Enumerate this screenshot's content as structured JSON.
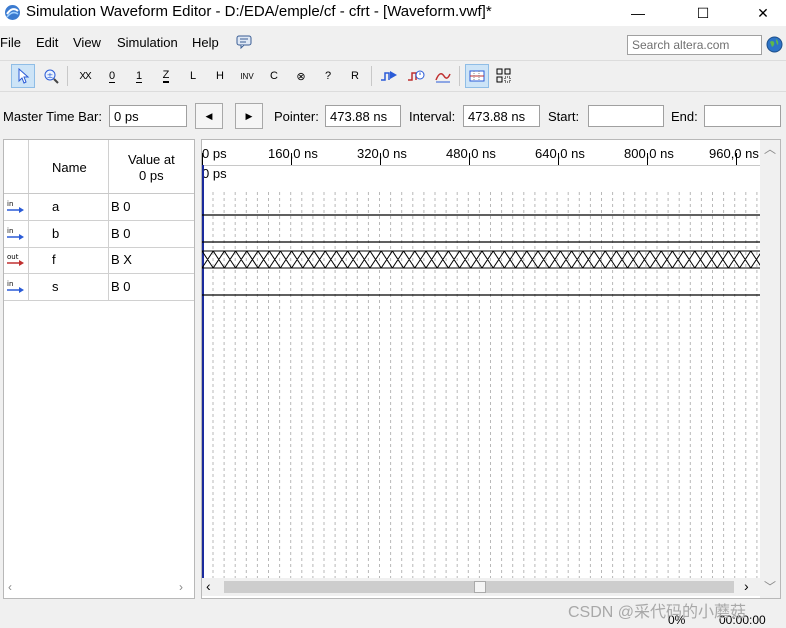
{
  "window": {
    "title": "Simulation Waveform Editor - D:/EDA/emple/cf - cfrt - [Waveform.vwf]*",
    "minimize_glyph": "—",
    "maximize_glyph": "☐",
    "close_glyph": "✕"
  },
  "menu": {
    "items": [
      "File",
      "Edit",
      "View",
      "Simulation",
      "Help"
    ],
    "search_placeholder": "Search altera.com"
  },
  "toolbar": {
    "icons": [
      "selection-tool-icon",
      "zoom-tool-icon",
      "forcing-unknown-icon",
      "forcing-low-icon",
      "forcing-high-icon",
      "high-impedance-icon",
      "weak-low-icon",
      "weak-high-icon",
      "invert-icon",
      "count-value-icon",
      "clock-icon",
      "random-value-icon",
      "arbitrary-value-icon",
      "run-functional-sim-icon",
      "run-timing-sim-icon",
      "generate-netlist-icon",
      "snap-to-grid-icon",
      "grid-settings-icon"
    ],
    "glyphs": {
      "forcing_unknown": "XX",
      "forcing_low": "0",
      "forcing_high": "1",
      "high_impedance": "Z",
      "weak_low": "L",
      "weak_high": "H",
      "invert": "INV",
      "count_value": "C",
      "clock": "⊗",
      "random_value": "?",
      "arbitrary_value": "R"
    }
  },
  "timebar": {
    "master_label": "Master Time Bar:",
    "master_value": "0 ps",
    "prev_glyph": "◀",
    "next_glyph": "▶",
    "pointer_label": "Pointer:",
    "pointer_value": "473.88 ns",
    "interval_label": "Interval:",
    "interval_value": "473.88 ns",
    "start_label": "Start:",
    "start_value": "",
    "end_label": "End:",
    "end_value": ""
  },
  "signals": {
    "header_name": "Name",
    "header_value_line1": "Value at",
    "header_value_line2": "0 ps",
    "rows": [
      {
        "type": "in",
        "name": "a",
        "value": "B 0"
      },
      {
        "type": "in",
        "name": "b",
        "value": "B 0"
      },
      {
        "type": "out",
        "name": "f",
        "value": "B X"
      },
      {
        "type": "in",
        "name": "s",
        "value": "B 0"
      }
    ]
  },
  "waveform": {
    "ticks": [
      "0 ps",
      "160,0 ns",
      "320,0 ns",
      "480,0 ns",
      "640,0 ns",
      "800,0 ns",
      "960,0 ns"
    ],
    "cursor_label": "0 ps"
  },
  "status": {
    "percent": "0%",
    "time": "00:00:00"
  },
  "watermark": "CSDN @采代码的小蘑菇",
  "colors": {
    "cursor": "#1a2a9c",
    "in_icon": "#2a5bd7",
    "out_icon": "#c03030"
  }
}
